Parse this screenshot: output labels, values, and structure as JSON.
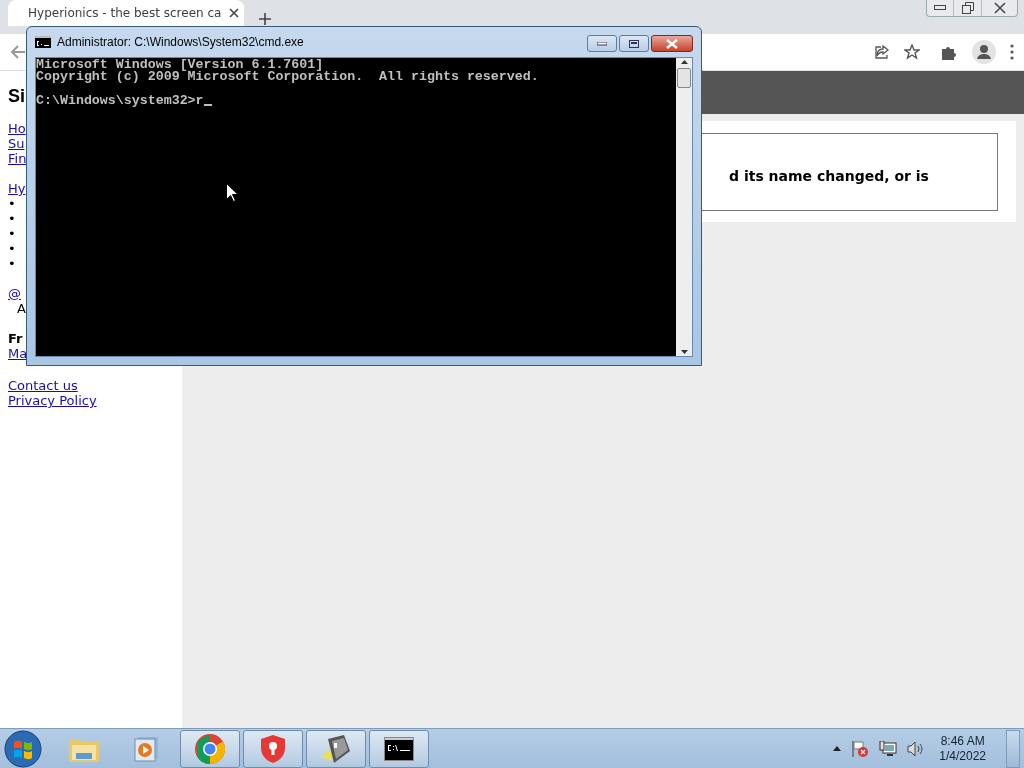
{
  "browser": {
    "tab": {
      "title": "Hyperionics - the best screen ca",
      "selected": true
    },
    "page": {
      "site_title": "Si",
      "nav_links": [
        "Ho",
        "Su",
        "Fin"
      ],
      "section_link": "Hy",
      "bullets": [
        "•",
        "•",
        "•",
        "•",
        "•"
      ],
      "social_link": "@",
      "social_note": "A",
      "free_heading": "Fr",
      "free_link": "Ma",
      "footer_links": [
        "Contact us",
        "Privacy Policy"
      ],
      "message": "d its name changed, or is"
    }
  },
  "console_window": {
    "title": "Administrator: C:\\Windows\\System32\\cmd.exe",
    "output": [
      "Microsoft Windows [Version 6.1.7601]",
      "Copyright (c) 2009 Microsoft Corporation.  All rights reserved."
    ],
    "prompt": "C:\\Windows\\system32>r"
  },
  "taskbar": {
    "apps": [
      {
        "kind": "explorer",
        "running": false
      },
      {
        "kind": "media",
        "running": false
      },
      {
        "kind": "chrome",
        "running": true
      },
      {
        "kind": "shield",
        "running": true
      },
      {
        "kind": "tool",
        "running": true
      },
      {
        "kind": "console",
        "running": true
      }
    ],
    "clock": {
      "time": "8:46 AM",
      "date": "1/4/2022"
    }
  }
}
